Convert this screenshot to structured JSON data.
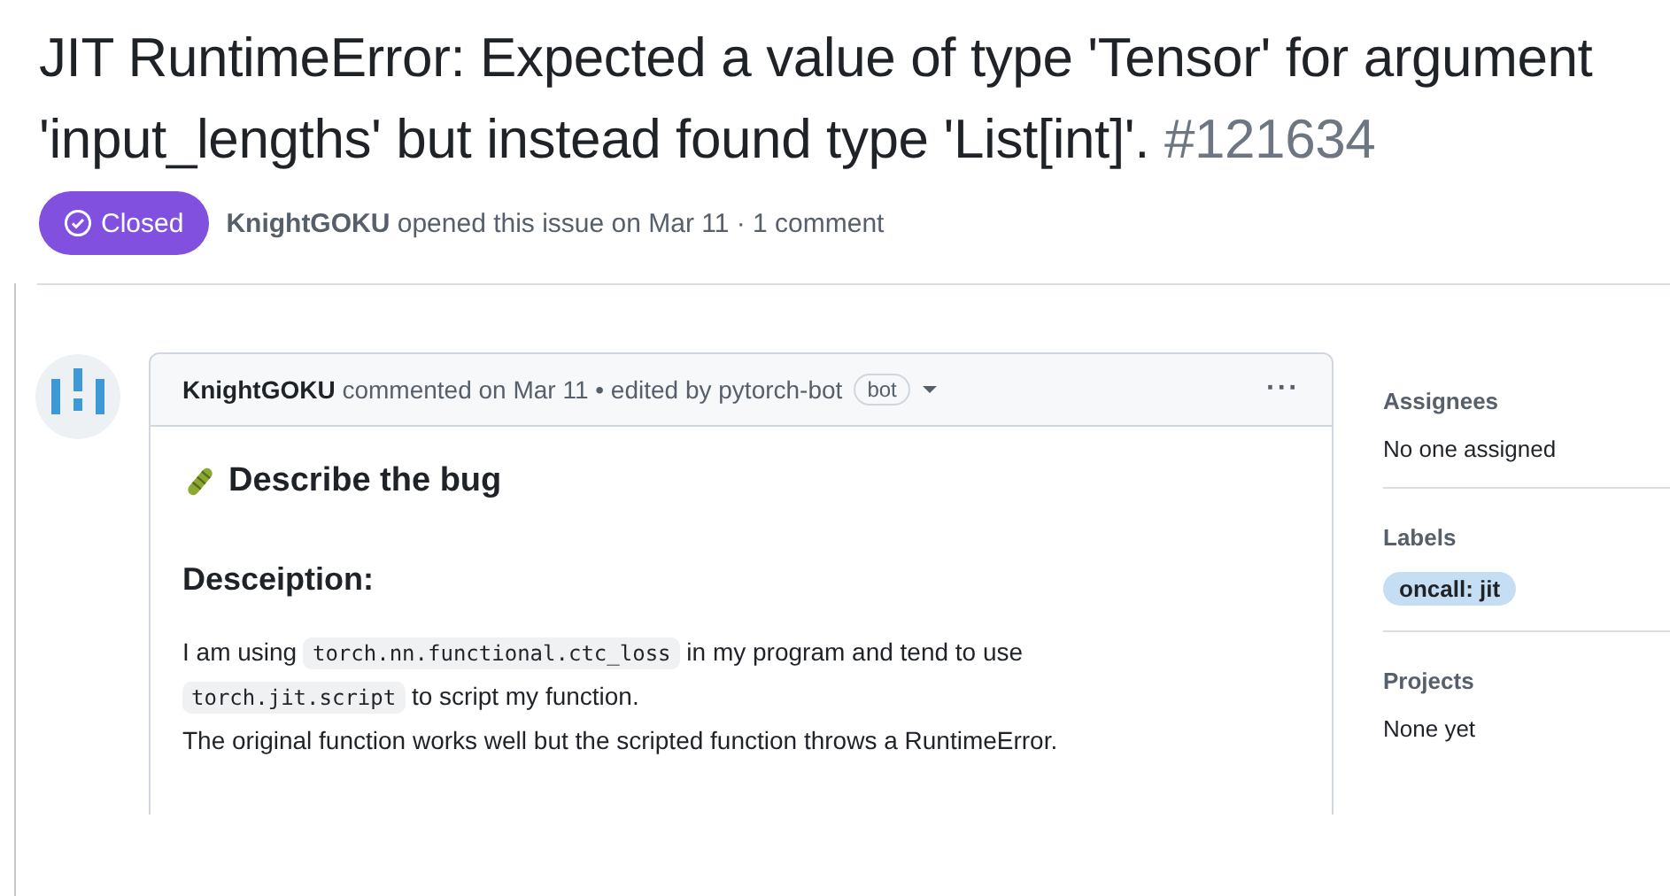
{
  "issue": {
    "title": "JIT RuntimeError: Expected a value of type 'Tensor' for argument 'input_lengths' but instead found type 'List[int]'.",
    "number": "#121634",
    "state": {
      "label": "Closed",
      "kind": "closed"
    },
    "author": "KnightGOKU",
    "meta": "opened this issue on Mar 11 · 1 comment"
  },
  "comment": {
    "author": "KnightGOKU",
    "meta": "commented on Mar 11 • edited by pytorch-bot",
    "badge": "bot",
    "menu": "···",
    "heading": "Describe the bug",
    "subheading": "Desceiption:",
    "paragraphs": [
      [
        {
          "kind": "text",
          "text": "I am using "
        },
        {
          "kind": "code",
          "text": "torch.nn.functional.ctc_loss"
        },
        {
          "kind": "text",
          "text": " in my program and tend to use "
        },
        {
          "kind": "code",
          "text": "torch.jit.script"
        },
        {
          "kind": "text",
          "text": " to script my function."
        }
      ],
      [
        {
          "kind": "text",
          "text": "The original function works well but the scripted function throws a RuntimeError."
        }
      ]
    ]
  },
  "sidebar": [
    {
      "title": "Assignees",
      "kind": "text",
      "value": "No one assigned"
    },
    {
      "title": "Labels",
      "kind": "label",
      "value": "oncall: jit"
    },
    {
      "title": "Projects",
      "kind": "text",
      "value": "None yet"
    }
  ]
}
